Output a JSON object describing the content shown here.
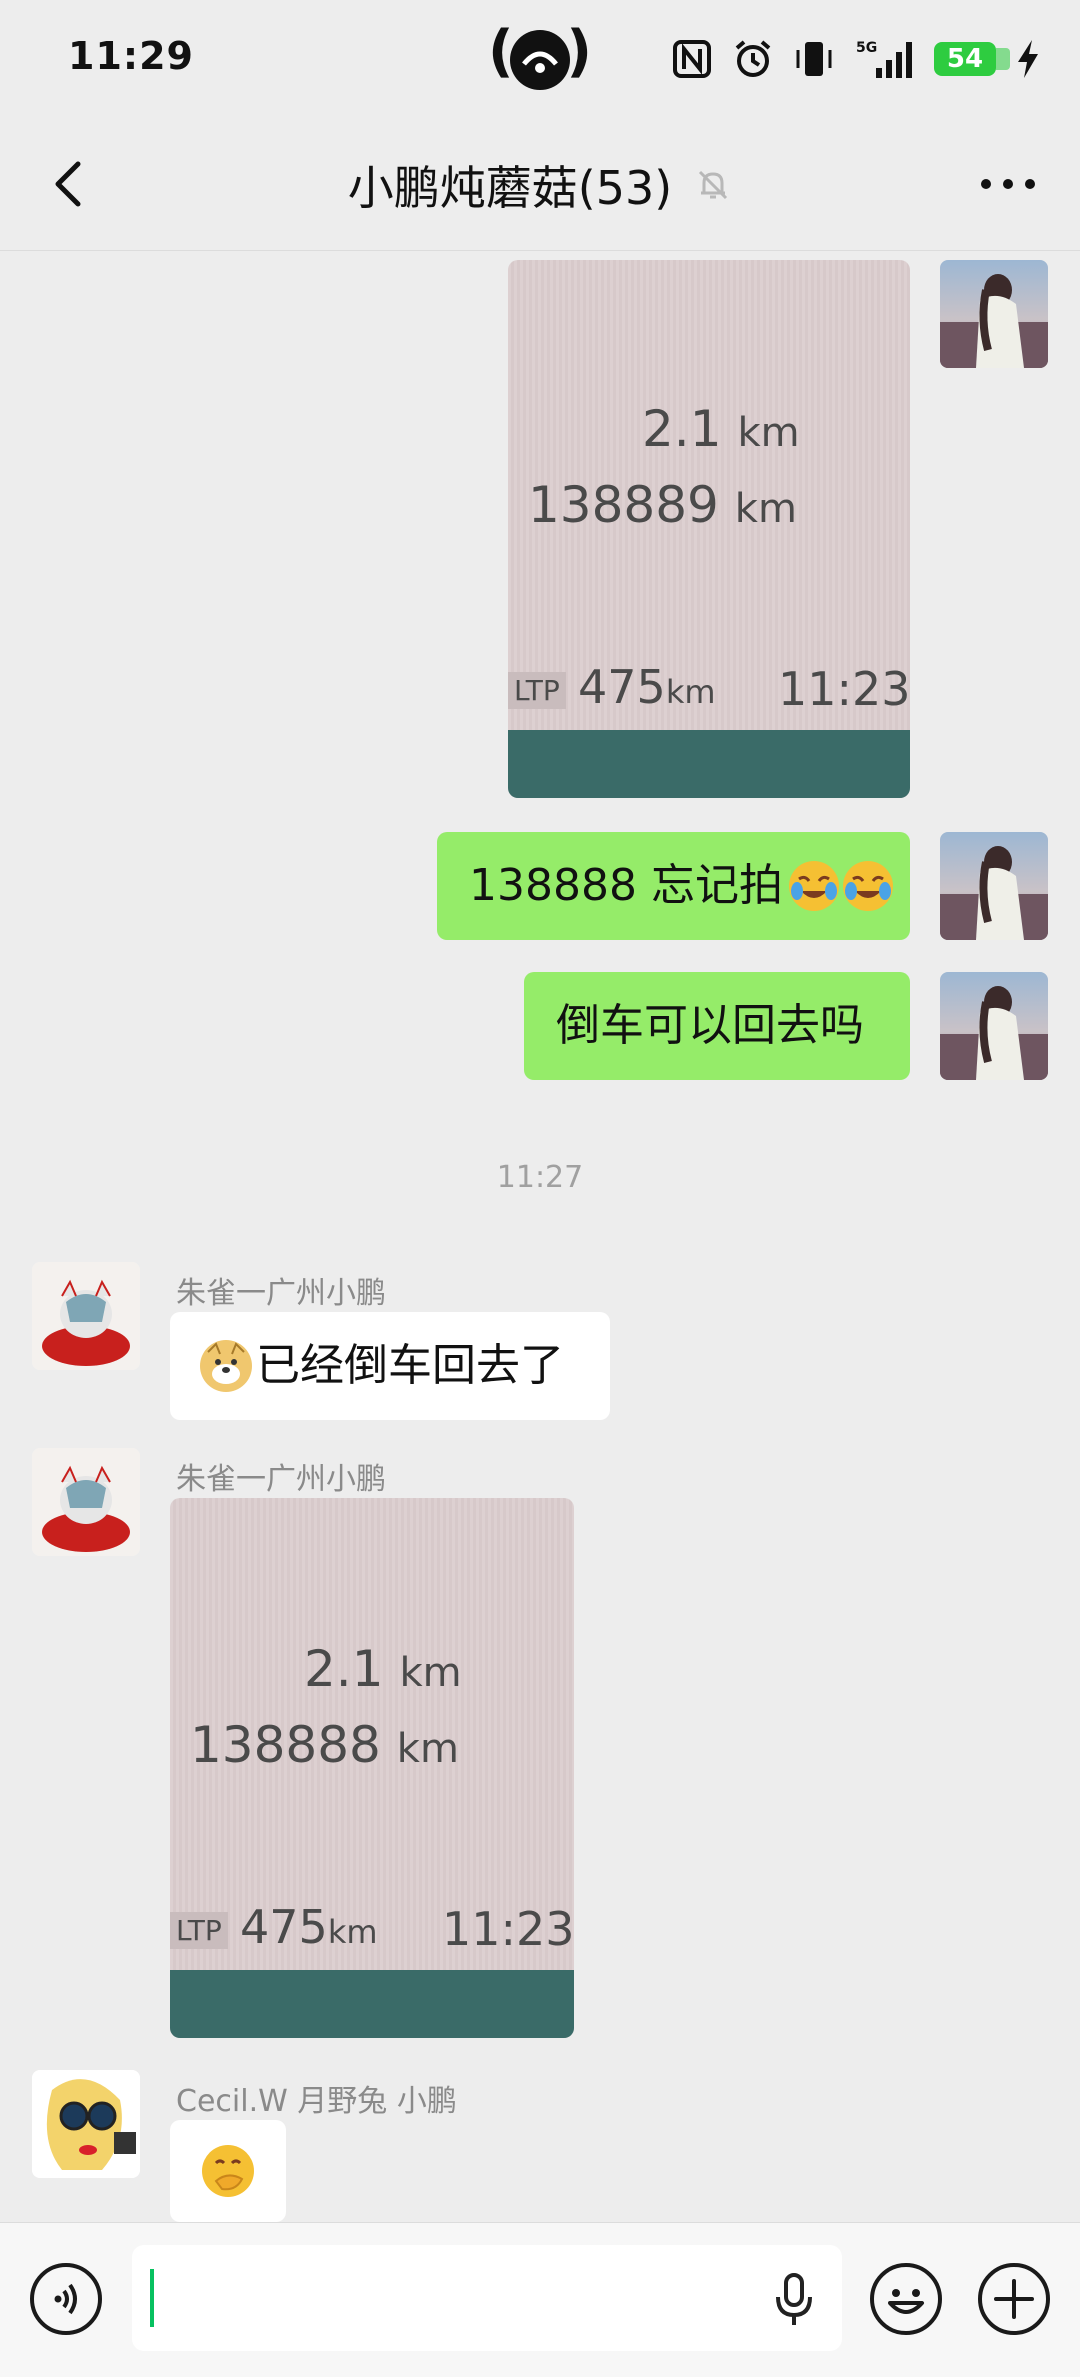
{
  "status_bar": {
    "time": "11:29",
    "battery": "54",
    "network": "5G",
    "battery_color": "#2ecc40"
  },
  "header": {
    "title": "小鹏炖蘑菇(53)",
    "back_icon": "chevron-left-icon",
    "mute_icon": "bell-muted-icon",
    "more_icon": "more-dots-icon"
  },
  "messages": {
    "photo1": {
      "line1": "2.1",
      "unit1": "km",
      "line2": "138889",
      "unit2": "km",
      "mode": "LTP",
      "range": "475",
      "range_unit": "km",
      "clock": "11:23"
    },
    "msg_forgot": {
      "text": "138888 忘记拍"
    },
    "msg_reverse": {
      "text": "倒车可以回去吗"
    },
    "time_separator": "11:27",
    "reply1": {
      "sender": "朱雀一广州小鹏",
      "text": "已经倒车回去了"
    },
    "reply2": {
      "sender": "朱雀一广州小鹏"
    },
    "photo2": {
      "line1": "2.1",
      "unit1": "km",
      "line2": "138888",
      "unit2": "km",
      "mode": "LTP",
      "range": "475",
      "range_unit": "km",
      "clock": "11:23"
    },
    "reply3": {
      "sender": "Cecil.W 月野兔 小鹏"
    }
  },
  "input_bar": {
    "value": "",
    "voice_icon": "voice-icon",
    "mic_icon": "microphone-icon",
    "emoji_icon": "emoji-icon",
    "plus_icon": "plus-icon"
  },
  "colors": {
    "chat_bg": "#ededed",
    "bubble_sent": "#95ec69",
    "bubble_received": "#ffffff",
    "accent": "#07c160"
  }
}
